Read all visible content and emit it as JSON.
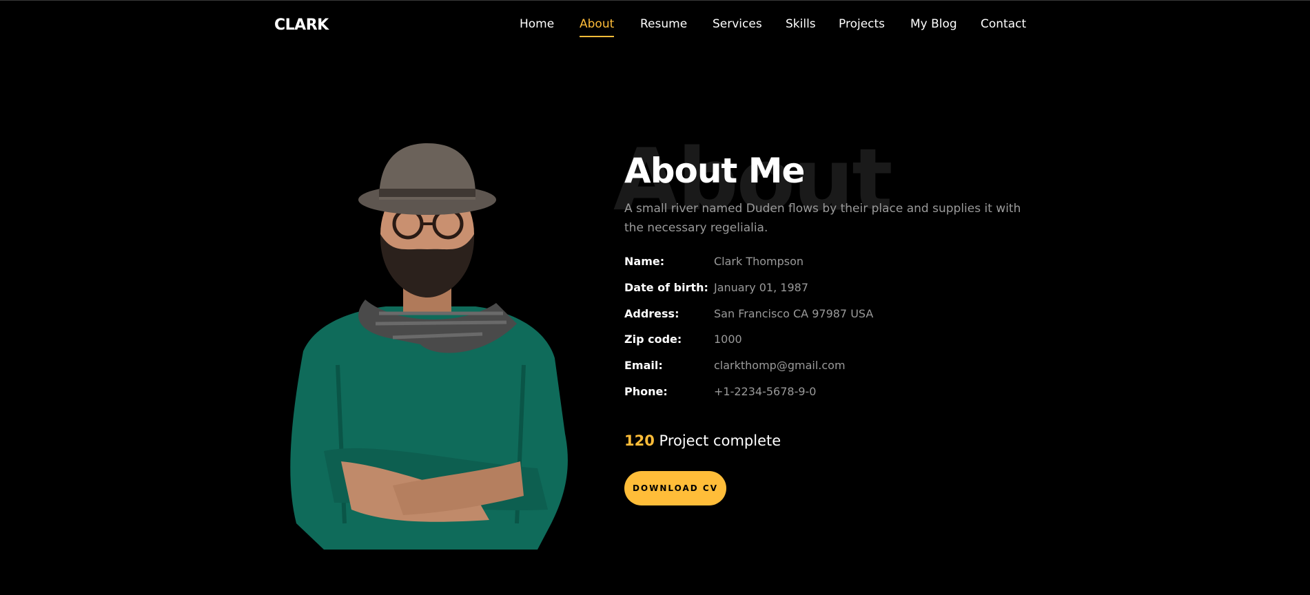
{
  "brand": {
    "name": "CLARK"
  },
  "nav": {
    "items": [
      {
        "label": "Home"
      },
      {
        "label": "About",
        "active": true
      },
      {
        "label": "Resume"
      },
      {
        "label": "Services"
      },
      {
        "label": "Skills"
      },
      {
        "label": "Projects"
      },
      {
        "label": "My Blog"
      },
      {
        "label": "Contact"
      }
    ]
  },
  "about": {
    "bg_word": "About",
    "title": "About Me",
    "intro": "A small river named Duden flows by their place and supplies it with the necessary regelialia.",
    "info": [
      {
        "label": "Name:",
        "value": "Clark Thompson"
      },
      {
        "label": "Date of birth:",
        "value": "January 01, 1987"
      },
      {
        "label": "Address:",
        "value": "San Francisco CA 97987 USA"
      },
      {
        "label": "Zip code:",
        "value": "1000"
      },
      {
        "label": "Email:",
        "value": "clarkthomp@gmail.com"
      },
      {
        "label": "Phone:",
        "value": "+1-2234-5678-9-0"
      }
    ],
    "projects_count": "120",
    "projects_label": "Project complete",
    "cv_button": "DOWNLOAD CV"
  },
  "colors": {
    "background": "#000000",
    "accent": "#ffbd39",
    "muted_text": "#9a9a9a"
  }
}
